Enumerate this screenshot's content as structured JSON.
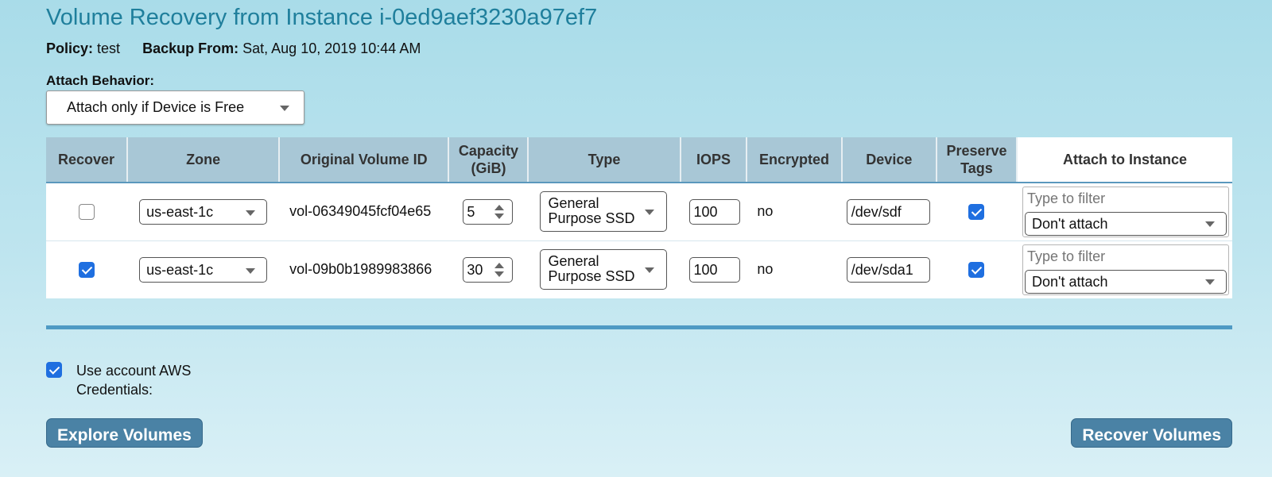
{
  "page": {
    "title": "Volume Recovery from Instance i-0ed9aef3230a97ef7",
    "policy_label": "Policy:",
    "policy_value": "test",
    "backup_label": "Backup From:",
    "backup_value": "Sat, Aug 10, 2019 10:44 AM"
  },
  "attach_behavior": {
    "label": "Attach Behavior:",
    "selected": "Attach only if Device is Free"
  },
  "table": {
    "headers": {
      "recover": "Recover",
      "zone": "Zone",
      "volume_id": "Original Volume ID",
      "capacity_1": "Capacity",
      "capacity_2": "(GiB)",
      "type": "Type",
      "iops": "IOPS",
      "encrypted": "Encrypted",
      "device": "Device",
      "tags_1": "Preserve",
      "tags_2": "Tags",
      "attach": "Attach to Instance"
    },
    "rows": [
      {
        "recover": false,
        "zone": "us-east-1c",
        "volume_id": "vol-06349045fcf04e65",
        "capacity": "5",
        "type": "General Purpose SSD",
        "iops": "100",
        "encrypted": "no",
        "device": "/dev/sdf",
        "preserve_tags": true,
        "attach_filter_placeholder": "Type to filter",
        "attach_selected": "Don't attach"
      },
      {
        "recover": true,
        "zone": "us-east-1c",
        "volume_id": "vol-09b0b1989983866",
        "capacity": "30",
        "type": "General Purpose SSD",
        "iops": "100",
        "encrypted": "no",
        "device": "/dev/sda1",
        "preserve_tags": true,
        "attach_filter_placeholder": "Type to filter",
        "attach_selected": "Don't attach"
      }
    ]
  },
  "credentials": {
    "checked": true,
    "label": "Use account AWS Credentials:"
  },
  "buttons": {
    "explore": "Explore Volumes",
    "recover": "Recover Volumes"
  },
  "colors": {
    "title": "#1f7f9c",
    "header_bg": "#a8c7d6",
    "accent": "#4f9ac4",
    "button": "#4a82a5",
    "checkbox": "#1f6fe0"
  }
}
